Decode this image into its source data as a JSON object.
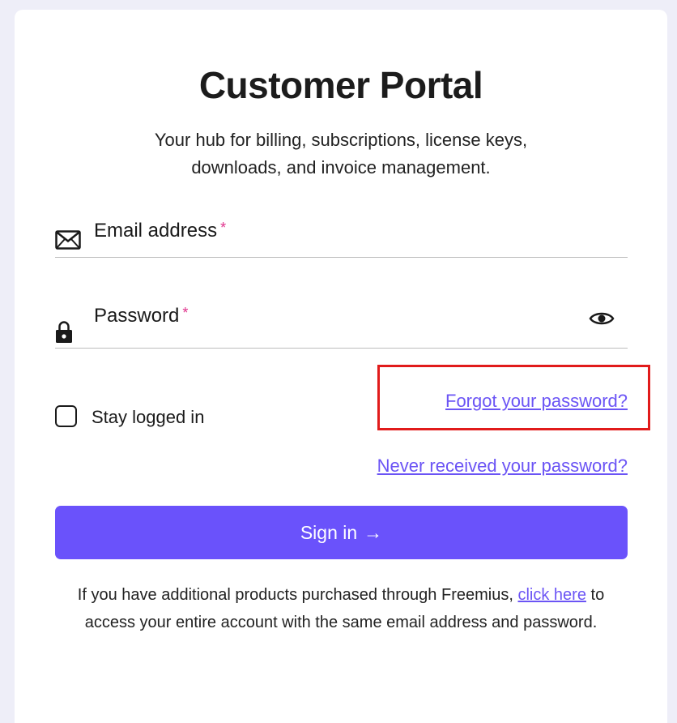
{
  "portal": {
    "title": "Customer Portal",
    "subtitle": "Your hub for billing, subscriptions, license keys, downloads, and invoice management."
  },
  "form": {
    "email_label": "Email address",
    "password_label": "Password",
    "required_marker": "*",
    "stay_logged_in_label": "Stay logged in",
    "stay_logged_in_checked": false,
    "forgot_password_link": "Forgot your password?",
    "never_received_link": "Never received your password?",
    "sign_in_label": "Sign in",
    "sign_in_arrow": "→"
  },
  "footer": {
    "text_before": "If you have additional products purchased through Freemius,",
    "link": "click here",
    "text_after": "to access your entire account with the same email address and password."
  },
  "icons": {
    "email": "envelope-icon",
    "password": "lock-icon",
    "toggle_visibility": "eye-icon",
    "sign_in_arrow": "arrow-right-icon"
  },
  "colors": {
    "page_background": "#eeeef8",
    "accent": "#6a52fb",
    "link": "#6b54f5",
    "required": "#e0338d",
    "highlight_box": "#e11b1b"
  }
}
